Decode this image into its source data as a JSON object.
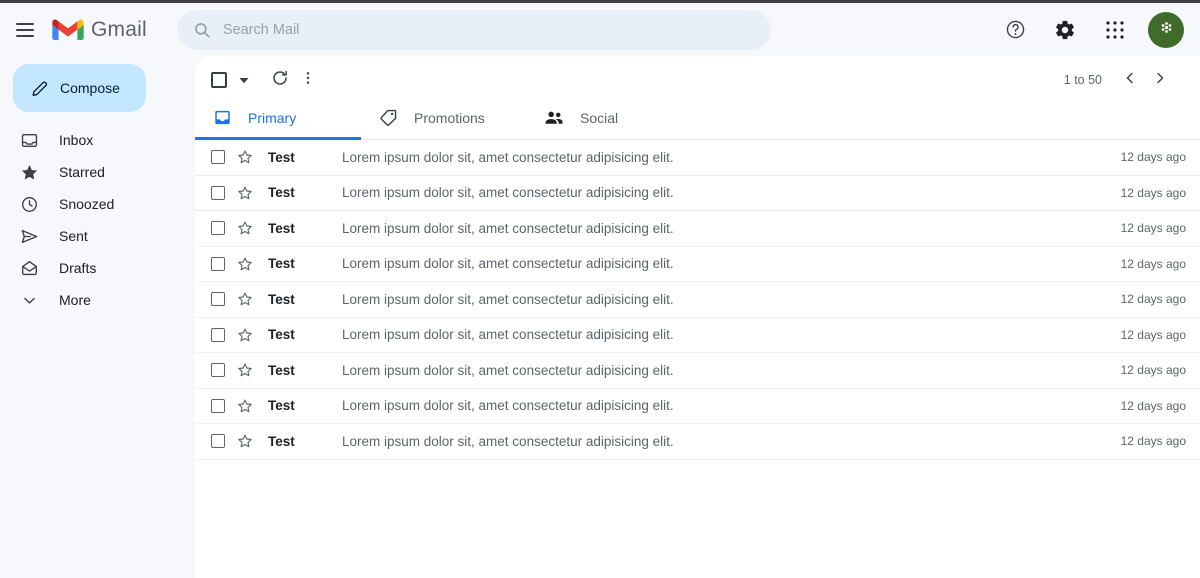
{
  "app": {
    "brand_name": "Gmail"
  },
  "header": {
    "menu_icon": "hamburger-icon",
    "logo_icon": "gmail-logo-icon",
    "search": {
      "icon": "search-icon",
      "placeholder": "Search Mail",
      "value": ""
    },
    "actions": [
      {
        "name": "help-button",
        "icon": "help-circle-icon"
      },
      {
        "name": "settings-button",
        "icon": "gear-icon"
      },
      {
        "name": "apps-button",
        "icon": "grid-apps-icon"
      }
    ],
    "avatar": {
      "icon": "flower-asterisk-icon",
      "color": "#3f6b2b"
    }
  },
  "sidebar": {
    "compose": {
      "label": "Compose",
      "icon": "pencil-icon",
      "bg": "#c2e7ff"
    },
    "items": [
      {
        "label": "Inbox",
        "icon": "inbox-icon"
      },
      {
        "label": "Starred",
        "icon": "star-filled-icon"
      },
      {
        "label": "Snoozed",
        "icon": "clock-icon"
      },
      {
        "label": "Sent",
        "icon": "send-icon"
      },
      {
        "label": "Drafts",
        "icon": "draft-envelope-icon"
      },
      {
        "label": "More",
        "icon": "chevron-down-icon"
      }
    ]
  },
  "toolbar": {
    "select_all": {
      "name": "select-all-checkbox",
      "icon": "checkbox-icon"
    },
    "select_caret": {
      "name": "select-dropdown-caret",
      "icon": "caret-down-icon"
    },
    "refresh": {
      "name": "refresh-button",
      "icon": "refresh-icon"
    },
    "more": {
      "name": "more-options-button",
      "icon": "kebab-menu-icon"
    },
    "pager": {
      "range_text": "1 to 50",
      "prev_icon": "chevron-left-icon",
      "next_icon": "chevron-right-icon"
    }
  },
  "tabs": [
    {
      "label": "Primary",
      "icon": "inbox-tab-icon",
      "active": true
    },
    {
      "label": "Promotions",
      "icon": "tag-icon",
      "active": false
    },
    {
      "label": "Social",
      "icon": "people-icon",
      "active": false
    }
  ],
  "accent_color": "#1a73e8",
  "emails": [
    {
      "sender": "Test",
      "subject": "Lorem ipsum dolor sit, amet consectetur adipisicing elit.",
      "date": "12 days ago"
    },
    {
      "sender": "Test",
      "subject": "Lorem ipsum dolor sit, amet consectetur adipisicing elit.",
      "date": "12 days ago"
    },
    {
      "sender": "Test",
      "subject": "Lorem ipsum dolor sit, amet consectetur adipisicing elit.",
      "date": "12 days ago"
    },
    {
      "sender": "Test",
      "subject": "Lorem ipsum dolor sit, amet consectetur adipisicing elit.",
      "date": "12 days ago"
    },
    {
      "sender": "Test",
      "subject": "Lorem ipsum dolor sit, amet consectetur adipisicing elit.",
      "date": "12 days ago"
    },
    {
      "sender": "Test",
      "subject": "Lorem ipsum dolor sit, amet consectetur adipisicing elit.",
      "date": "12 days ago"
    },
    {
      "sender": "Test",
      "subject": "Lorem ipsum dolor sit, amet consectetur adipisicing elit.",
      "date": "12 days ago"
    },
    {
      "sender": "Test",
      "subject": "Lorem ipsum dolor sit, amet consectetur adipisicing elit.",
      "date": "12 days ago"
    },
    {
      "sender": "Test",
      "subject": "Lorem ipsum dolor sit, amet consectetur adipisicing elit.",
      "date": "12 days ago"
    }
  ]
}
